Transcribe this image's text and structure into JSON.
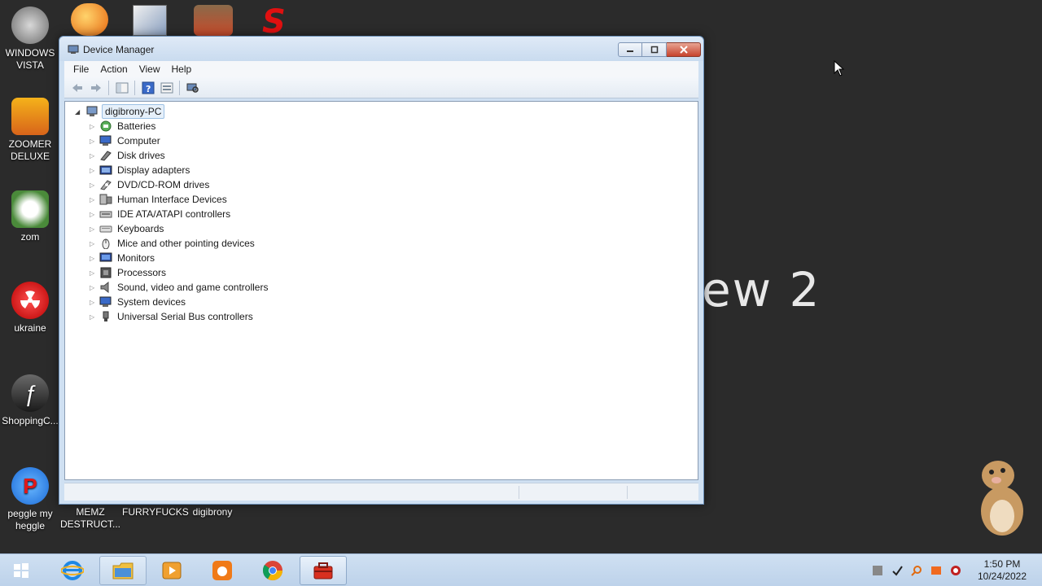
{
  "desktop": {
    "background_text": "ew 2",
    "icons": [
      {
        "label": "WINDOWS VISTA"
      },
      {
        "label": "ZOOMER DELUXE"
      },
      {
        "label": "zom"
      },
      {
        "label": "ukraine"
      },
      {
        "label": "ShoppingC..."
      },
      {
        "label": "peggle my heggle"
      },
      {
        "label": "MEMZ DESTRUCT..."
      },
      {
        "label": "FURRYFUCKS"
      },
      {
        "label": "digibrony"
      }
    ]
  },
  "window": {
    "title": "Device Manager",
    "menu": [
      "File",
      "Action",
      "View",
      "Help"
    ],
    "tree": {
      "root": "digibrony-PC",
      "items": [
        {
          "label": "Batteries",
          "icon": "battery-icon"
        },
        {
          "label": "Computer",
          "icon": "computer-icon"
        },
        {
          "label": "Disk drives",
          "icon": "disk-icon"
        },
        {
          "label": "Display adapters",
          "icon": "display-adapter-icon"
        },
        {
          "label": "DVD/CD-ROM drives",
          "icon": "dvd-icon"
        },
        {
          "label": "Human Interface Devices",
          "icon": "hid-icon"
        },
        {
          "label": "IDE ATA/ATAPI controllers",
          "icon": "ide-icon"
        },
        {
          "label": "Keyboards",
          "icon": "keyboard-icon"
        },
        {
          "label": "Mice and other pointing devices",
          "icon": "mouse-icon"
        },
        {
          "label": "Monitors",
          "icon": "monitor-icon"
        },
        {
          "label": "Processors",
          "icon": "processor-icon"
        },
        {
          "label": "Sound, video and game controllers",
          "icon": "sound-icon"
        },
        {
          "label": "System devices",
          "icon": "system-icon"
        },
        {
          "label": "Universal Serial Bus controllers",
          "icon": "usb-icon"
        }
      ]
    }
  },
  "taskbar": {
    "clock_time": "1:50 PM",
    "clock_date": "10/24/2022"
  },
  "colors": {
    "desktop_bg": "#2b2b2b",
    "window_frame": "#cfe0f2",
    "close_red": "#c7432c"
  }
}
